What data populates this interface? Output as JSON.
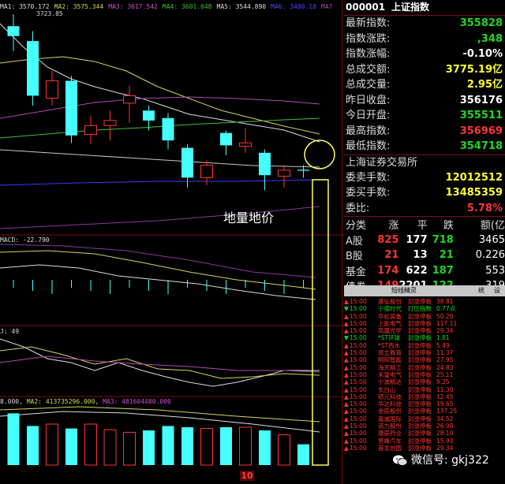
{
  "chart_legend": {
    "ma1": "MA1: 3570.172",
    "ma2": "MA2: 3575.344",
    "ma3": "MA3: 3617.542",
    "ma4": "MA4: 3601.048",
    "ma5": "MA5: 3544.890",
    "ma6": "MA6: 3480.18",
    "ma7": "MA7",
    "peak_label": "3723.85"
  },
  "macd_legend": "MACD: -22.790",
  "kdj_legend": "J: 49",
  "vol_legend": {
    "ma1": "8.000",
    "ma2": "MA2: 413735296.000",
    "ma3": "MA3: 481604480.000"
  },
  "annotation": "地量地价",
  "date_mark": "10",
  "watermark": "微信号: gkj322",
  "quote": {
    "code": "000001",
    "name": "上证指数",
    "rows": [
      {
        "label": "最新指数:",
        "value": "355828",
        "color": "green"
      },
      {
        "label": "指数涨跌:",
        "value": ",348",
        "color": "green"
      },
      {
        "label": "指数涨幅:",
        "value": "-0.10%",
        "color": "white"
      },
      {
        "label": "总成交额:",
        "value": "3775.19亿",
        "color": "yellow"
      },
      {
        "label": "总成交量:",
        "value": "2.95亿",
        "color": "yellow"
      },
      {
        "label": "昨日收盘:",
        "value": "356176",
        "color": "white"
      },
      {
        "label": "今日开盘:",
        "value": "355511",
        "color": "green"
      },
      {
        "label": "最高指数:",
        "value": "356969",
        "color": "red"
      },
      {
        "label": "最低指数:",
        "value": "354718",
        "color": "green"
      }
    ],
    "exchange": "上海证券交易所",
    "rows2": [
      {
        "label": "委卖手数:",
        "value": "12012512",
        "color": "yellow"
      },
      {
        "label": "委买手数:",
        "value": "13485359",
        "color": "yellow"
      },
      {
        "label": "委比:",
        "value": "5.78%",
        "color": "red"
      }
    ],
    "stat_header": [
      "分类",
      "涨",
      "平",
      "跌",
      "额(亿"
    ],
    "stats": [
      {
        "cat": "A股",
        "up": "825",
        "flat": "177",
        "down": "718",
        "amt": "3465"
      },
      {
        "cat": "B股",
        "up": "21",
        "flat": "13",
        "down": "21",
        "amt": "0.226"
      },
      {
        "cat": "基金",
        "up": "174",
        "flat": "622",
        "down": "187",
        "amt": "553"
      },
      {
        "cat": "债券",
        "up": "149",
        "flat": "2201",
        "down": "122",
        "amt": "319"
      }
    ]
  },
  "tabs": {
    "main": "短线精灵",
    "t2": "统",
    "t3": "设"
  },
  "alerts": [
    {
      "time": "15:00",
      "name": "盛弘股份",
      "type": "封涨停板",
      "val": "38.81",
      "dir": "up"
    },
    {
      "time": "15:00",
      "name": "宁德时代",
      "type": "打压指数",
      "val": "0.77点",
      "dir": "down"
    },
    {
      "time": "15:00",
      "name": "华虹装备",
      "type": "封涨停板",
      "val": "50.20",
      "dir": "up"
    },
    {
      "time": "15:00",
      "name": "上能电气",
      "type": "封涨停板",
      "val": "117.11",
      "dir": "up"
    },
    {
      "time": "15:00",
      "name": "凤凰光学",
      "type": "封涨停板",
      "val": "29.34",
      "dir": "up"
    },
    {
      "time": "15:00",
      "name": "*ST环球",
      "type": "封涨停板",
      "val": "1.81",
      "dir": "down"
    },
    {
      "time": "15:00",
      "name": "*ST西水",
      "type": "封涨停板",
      "val": "5.49",
      "dir": "up"
    },
    {
      "time": "15:00",
      "name": "昂立教育",
      "type": "封涨停板",
      "val": "11.37",
      "dir": "up"
    },
    {
      "time": "15:00",
      "name": "明阳智能",
      "type": "封涨停板",
      "val": "27.95",
      "dir": "up"
    },
    {
      "time": "15:00",
      "name": "海天精工",
      "type": "封涨停板",
      "val": "24.83",
      "dir": "up"
    },
    {
      "time": "15:00",
      "name": "禾望电气",
      "type": "封涨停板",
      "val": "25.11",
      "dir": "up"
    },
    {
      "time": "15:00",
      "name": "宁波精达",
      "type": "封涨停板",
      "val": "9.25",
      "dir": "up"
    },
    {
      "time": "15:00",
      "name": "长白山",
      "type": "封涨停板",
      "val": "11.30",
      "dir": "up"
    },
    {
      "time": "15:00",
      "name": "硕元科技",
      "type": "封涨停板",
      "val": "12.45",
      "dir": "up"
    },
    {
      "time": "15:00",
      "name": "华达科技",
      "type": "封涨停板",
      "val": "19.65",
      "dir": "up"
    },
    {
      "time": "15:00",
      "name": "金辰股份",
      "type": "封涨停板",
      "val": "137.25",
      "dir": "up"
    },
    {
      "time": "15:00",
      "name": "嘉诚国际",
      "type": "封涨停板",
      "val": "34.52",
      "dir": "up"
    },
    {
      "time": "15:00",
      "name": "诺力股份",
      "type": "封涨停板",
      "val": "26.98",
      "dir": "up"
    },
    {
      "time": "15:00",
      "name": "康辰药业",
      "type": "封涨停板",
      "val": "28.10",
      "dir": "up"
    },
    {
      "time": "15:00",
      "name": "景峰汽车",
      "type": "封涨停板",
      "val": "15.93",
      "dir": "up"
    },
    {
      "time": "15:00",
      "name": "首龙创园",
      "type": "封涨停板",
      "val": "29.34",
      "dir": "up"
    }
  ],
  "candles": [
    {
      "o": 3700,
      "c": 3680,
      "h": 3723.85,
      "l": 3650
    },
    {
      "o": 3670,
      "c": 3560,
      "h": 3690,
      "l": 3540
    },
    {
      "o": 3555,
      "c": 3590,
      "h": 3610,
      "l": 3540
    },
    {
      "o": 3590,
      "c": 3480,
      "h": 3600,
      "l": 3465
    },
    {
      "o": 3482,
      "c": 3500,
      "h": 3520,
      "l": 3462
    },
    {
      "o": 3500,
      "c": 3510,
      "h": 3530,
      "l": 3470
    },
    {
      "o": 3545,
      "c": 3560,
      "h": 3580,
      "l": 3505
    },
    {
      "o": 3530,
      "c": 3510,
      "h": 3540,
      "l": 3490
    },
    {
      "o": 3515,
      "c": 3470,
      "h": 3525,
      "l": 3452
    },
    {
      "o": 3455,
      "c": 3395,
      "h": 3462,
      "l": 3375
    },
    {
      "o": 3395,
      "c": 3420,
      "h": 3430,
      "l": 3380
    },
    {
      "o": 3485,
      "c": 3460,
      "h": 3490,
      "l": 3440
    },
    {
      "o": 3458,
      "c": 3465,
      "h": 3495,
      "l": 3445
    },
    {
      "o": 3445,
      "c": 3400,
      "h": 3452,
      "l": 3370
    },
    {
      "o": 3398,
      "c": 3410,
      "h": 3420,
      "l": 3375
    },
    {
      "o": 3411,
      "c": 3409,
      "h": 3420,
      "l": 3395
    }
  ],
  "volumes": [
    0.82,
    0.62,
    0.65,
    0.58,
    0.65,
    0.56,
    0.52,
    0.55,
    0.62,
    0.6,
    0.58,
    0.6,
    0.6,
    0.55,
    0.48,
    0.33
  ],
  "colors": {
    "up": "#ff3535",
    "down": "#46ffff",
    "bg": "#000000",
    "annotation": "#ffff66"
  }
}
